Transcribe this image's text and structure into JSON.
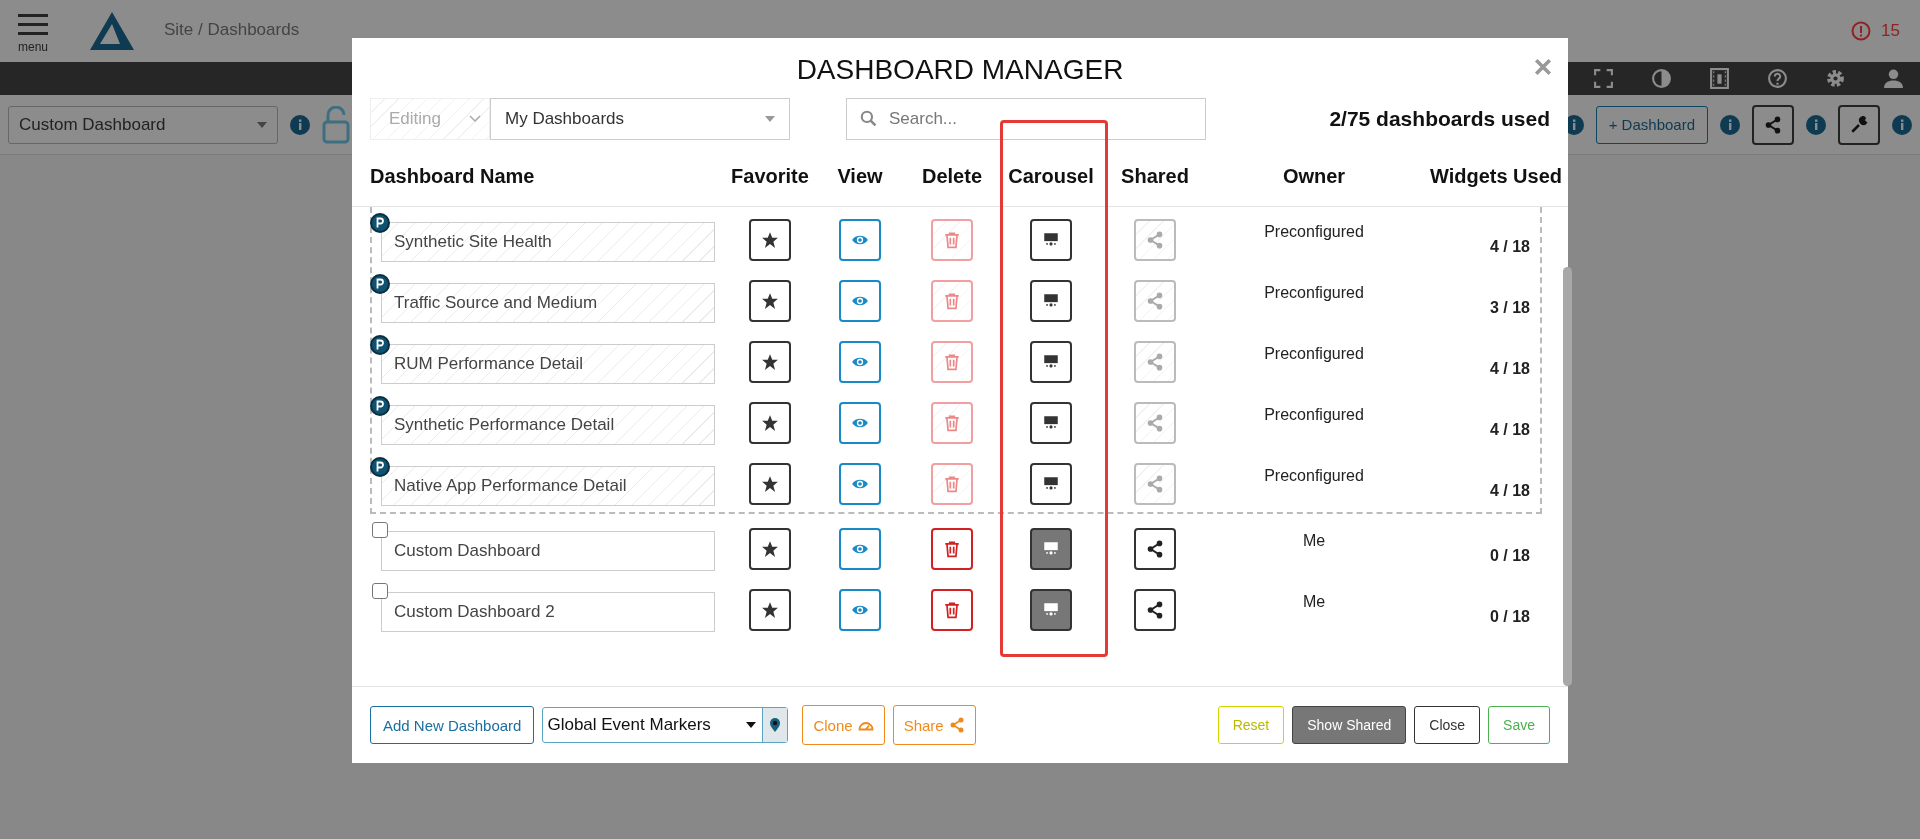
{
  "background": {
    "menu_label": "menu",
    "breadcrumb": "Site / Dashboards",
    "alert_count": "15",
    "dashboard_select": "Custom Dashboard",
    "add_dashboard_button": "+ Dashboard"
  },
  "modal": {
    "title": "DASHBOARD MANAGER",
    "mode_select": {
      "value": "Editing",
      "disabled": true
    },
    "filter_select": "My Dashboards",
    "search": {
      "placeholder": "Search..."
    },
    "usage": "2/75 dashboards used",
    "columns": [
      {
        "label": "Dashboard Name",
        "highlighted": false
      },
      {
        "label": "Favorite",
        "highlighted": false
      },
      {
        "label": "View",
        "highlighted": false
      },
      {
        "label": "Delete",
        "highlighted": false
      },
      {
        "label": "Carousel",
        "highlighted": true
      },
      {
        "label": "Shared",
        "highlighted": false
      },
      {
        "label": "Owner",
        "highlighted": false
      },
      {
        "label": "Widgets Used",
        "highlighted": false
      }
    ],
    "rows": [
      {
        "kind": "preconfigured",
        "name": "Synthetic Site Health",
        "carousel_on": false,
        "owner": "Preconfigured",
        "widgets": "4 / 18"
      },
      {
        "kind": "preconfigured",
        "name": "Traffic Source and Medium",
        "carousel_on": false,
        "owner": "Preconfigured",
        "widgets": "3 / 18"
      },
      {
        "kind": "preconfigured",
        "name": "RUM Performance Detail",
        "carousel_on": false,
        "owner": "Preconfigured",
        "widgets": "4 / 18"
      },
      {
        "kind": "preconfigured",
        "name": "Synthetic Performance Detail",
        "carousel_on": false,
        "owner": "Preconfigured",
        "widgets": "4 / 18"
      },
      {
        "kind": "preconfigured",
        "name": "Native App Performance Detail",
        "carousel_on": false,
        "owner": "Preconfigured",
        "widgets": "4 / 18"
      },
      {
        "kind": "custom",
        "checked": false,
        "name": "Custom Dashboard",
        "carousel_on": true,
        "owner": "Me",
        "widgets": "0 / 18"
      },
      {
        "kind": "custom",
        "checked": false,
        "name": "Custom Dashboard 2",
        "carousel_on": true,
        "owner": "Me",
        "widgets": "0 / 18"
      }
    ],
    "footer": {
      "add_button": "Add New Dashboard",
      "marker_select": "Global Event Markers",
      "clone_button": "Clone",
      "share_button": "Share",
      "buttons": [
        {
          "label": "Reset",
          "kind": "reset"
        },
        {
          "label": "Show Shared",
          "kind": "show-shared"
        },
        {
          "label": "Close",
          "kind": "close"
        },
        {
          "label": "Save",
          "kind": "save"
        }
      ]
    }
  }
}
